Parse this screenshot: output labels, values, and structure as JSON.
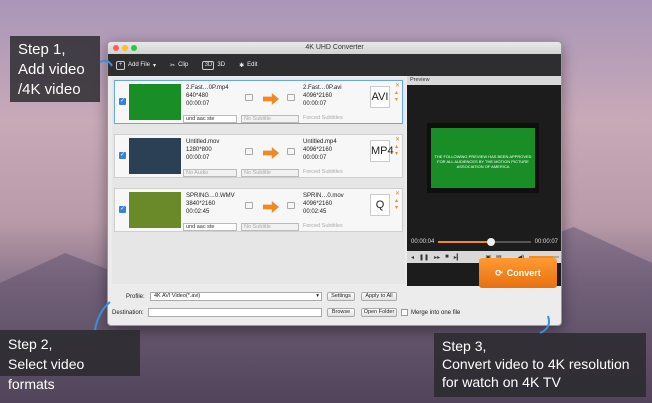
{
  "window": {
    "title": "4K UHD Converter"
  },
  "toolbar": {
    "add_file": "Add File",
    "clip": "Clip",
    "three_d": "3D",
    "edit": "Edit"
  },
  "files": [
    {
      "src_name": "2.Fast…0P.mp4",
      "src_res": "640*480",
      "src_dur": "00:00:07",
      "dst_name": "2.Fast…0P.avi",
      "dst_res": "4096*2160",
      "dst_dur": "00:00:07",
      "audio": "und aac ste",
      "subtitle": "No Subtitle",
      "forced": "Forced Subtitles",
      "format": "AVI",
      "thumb_color": "#1a8e26"
    },
    {
      "src_name": "Untitled.mov",
      "src_res": "1280*800",
      "src_dur": "00:00:07",
      "dst_name": "Untitled.mp4",
      "dst_res": "4096*2160",
      "dst_dur": "00:00:07",
      "audio": "No Audio",
      "subtitle": "No Subtitle",
      "forced": "Forced Subtitles",
      "format": "MP4",
      "thumb_color": "#2b3f55"
    },
    {
      "src_name": "SPRING…0.WMV",
      "src_res": "3840*2160",
      "src_dur": "00:02:45",
      "dst_name": "SPRIN…0.mov",
      "dst_res": "4096*2160",
      "dst_dur": "00:02:45",
      "audio": "und aac ste",
      "subtitle": "No Subtitle",
      "forced": "Forced Subtitles",
      "format": "Q",
      "thumb_color": "#6a8a2a"
    }
  ],
  "preview": {
    "label": "Preview",
    "overlay_text": "THE FOLLOWING PREVIEW HAS BEEN APPROVED FOR ALL AUDIENCES BY THE MOTION PICTURE ASSOCIATION OF AMERICA",
    "current_time": "00:00:04",
    "total_time": "00:00:07",
    "progress": 0.57,
    "volume": 0.8
  },
  "output": {
    "profile_label": "Profile:",
    "profile_value": "4K AVI Video(*.avi)",
    "settings": "Settings",
    "apply_all": "Apply to All",
    "destination_label": "Destination:",
    "destination_value": "",
    "browse": "Browse",
    "open_folder": "Open Folder",
    "merge": "Merge into one file",
    "convert": "Convert"
  },
  "annotations": {
    "step1": "Step 1,\nAdd video\n/4K video",
    "step2": "Step 2,\nSelect video formats",
    "step3": "Step 3,\nConvert video to 4K resolution\nfor watch on 4K TV"
  },
  "colors": {
    "accent": "#f08a24",
    "preview_green": "#1a8e26",
    "selection": "#3a7fd9"
  }
}
